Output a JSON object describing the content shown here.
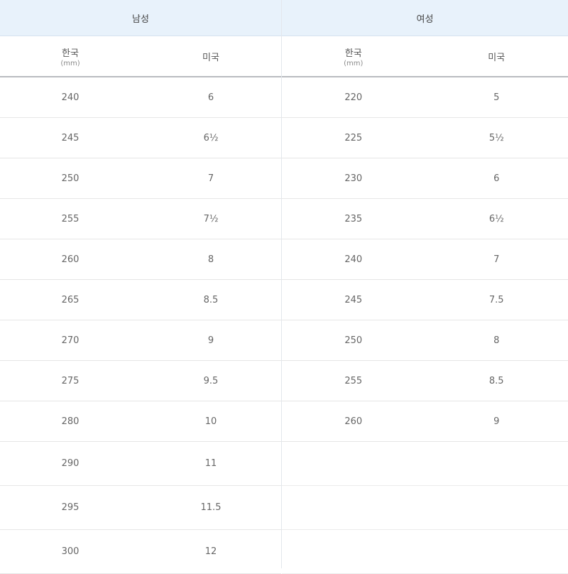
{
  "headers": {
    "men": "남성",
    "women": "여성",
    "korea": "한국",
    "korea_unit": "(mm)",
    "us": "미국"
  },
  "men_rows": [
    {
      "kr": "240",
      "us": "6"
    },
    {
      "kr": "245",
      "us": "6½"
    },
    {
      "kr": "250",
      "us": "7"
    },
    {
      "kr": "255",
      "us": "7½"
    },
    {
      "kr": "260",
      "us": "8"
    },
    {
      "kr": "265",
      "us": "8.5"
    },
    {
      "kr": "270",
      "us": "9"
    },
    {
      "kr": "275",
      "us": "9.5"
    },
    {
      "kr": "280",
      "us": "10"
    },
    {
      "kr": "290",
      "us": "11"
    },
    {
      "kr": "295",
      "us": "11.5"
    },
    {
      "kr": "300",
      "us": "12"
    }
  ],
  "women_rows": [
    {
      "kr": "220",
      "us": "5"
    },
    {
      "kr": "225",
      "us": "5½"
    },
    {
      "kr": "230",
      "us": "6"
    },
    {
      "kr": "235",
      "us": "6½"
    },
    {
      "kr": "240",
      "us": "7"
    },
    {
      "kr": "245",
      "us": "7.5"
    },
    {
      "kr": "250",
      "us": "8"
    },
    {
      "kr": "255",
      "us": "8.5"
    },
    {
      "kr": "260",
      "us": "9"
    }
  ],
  "colors": {
    "header_bg": "#e8f2fb",
    "row_border": "#e6e6e6",
    "text": "#666666"
  }
}
